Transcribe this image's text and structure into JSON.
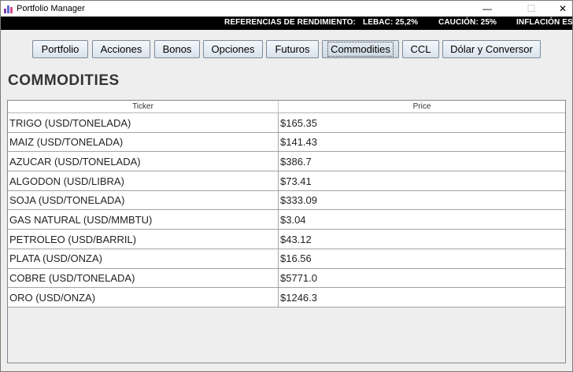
{
  "window": {
    "title": "Portfolio Manager",
    "min_glyph": "—",
    "max_glyph": "☐",
    "close_glyph": "✕",
    "icon": "bar-chart-icon"
  },
  "ticker": {
    "label": "REFERENCIAS DE RENDIMIENTO:",
    "lebac": "LEBAC: 25,2%",
    "caucion": "CAUCIÓN: 25%",
    "inflacion": "INFLACIÓN ESTIM"
  },
  "tabs": [
    {
      "label": "Portfolio"
    },
    {
      "label": "Acciones"
    },
    {
      "label": "Bonos"
    },
    {
      "label": "Opciones"
    },
    {
      "label": "Futuros"
    },
    {
      "label": "Commodities",
      "active": true
    },
    {
      "label": "CCL"
    },
    {
      "label": "Dólar y Conversor"
    }
  ],
  "page": {
    "heading": "COMMODITIES"
  },
  "table": {
    "columns": {
      "ticker": "Ticker",
      "price": "Price"
    },
    "rows": [
      {
        "ticker": "TRIGO (USD/TONELADA)",
        "price": "$165.35"
      },
      {
        "ticker": "MAIZ (USD/TONELADA)",
        "price": "$141.43"
      },
      {
        "ticker": "AZUCAR (USD/TONELADA)",
        "price": "$386.7"
      },
      {
        "ticker": "ALGODON (USD/LIBRA)",
        "price": "$73.41"
      },
      {
        "ticker": "SOJA (USD/TONELADA)",
        "price": "$333.09"
      },
      {
        "ticker": "GAS NATURAL (USD/MMBTU)",
        "price": "$3.04"
      },
      {
        "ticker": "PETROLEO (USD/BARRIL)",
        "price": "$43.12"
      },
      {
        "ticker": "PLATA (USD/ONZA)",
        "price": "$16.56"
      },
      {
        "ticker": "COBRE (USD/TONELADA)",
        "price": "$5771.0"
      },
      {
        "ticker": "ORO (USD/ONZA)",
        "price": "$1246.3"
      }
    ]
  }
}
